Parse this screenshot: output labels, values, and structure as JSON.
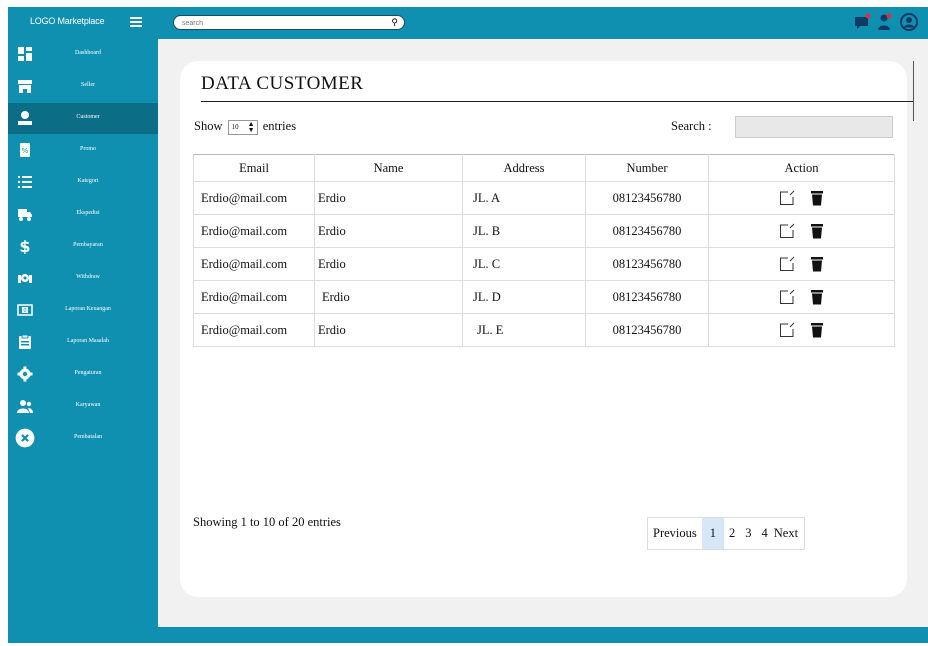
{
  "header": {
    "brand": "LOGO Marketplace",
    "search_placeholder": "search",
    "icons": [
      "chat-notification-icon",
      "user-notification-icon",
      "account-icon"
    ]
  },
  "sidebar": {
    "items": [
      {
        "label": "Dashboard",
        "icon": "dashboard-icon"
      },
      {
        "label": "Seller",
        "icon": "store-icon"
      },
      {
        "label": "Customer",
        "icon": "user-icon",
        "active": true
      },
      {
        "label": "Promo",
        "icon": "promo-tag-icon"
      },
      {
        "label": "Kategori",
        "icon": "list-icon"
      },
      {
        "label": "Ekspedisi",
        "icon": "truck-icon"
      },
      {
        "label": "Pembayaran",
        "icon": "dollar-icon"
      },
      {
        "label": "Withdraw",
        "icon": "withdraw-icon"
      },
      {
        "label": "Laporan Keuangan",
        "icon": "money-icon"
      },
      {
        "label": "Laporan Masalah",
        "icon": "report-icon"
      },
      {
        "label": "Pengaturan",
        "icon": "gear-icon"
      },
      {
        "label": "Karyawan",
        "icon": "users-icon"
      },
      {
        "label": "Pembatalan",
        "icon": "cancel-icon"
      }
    ]
  },
  "main": {
    "title": "DATA CUSTOMER",
    "show_label": "Show",
    "entries_value": "10",
    "entries_label": "entries",
    "search_label": "Search :",
    "columns": [
      "Email",
      "Name",
      "Address",
      "Number",
      "Action"
    ],
    "rows": [
      {
        "email": "Erdio@mail.com",
        "name": "Erdio",
        "address": "JL. A",
        "number": "08123456780"
      },
      {
        "email": "Erdio@mail.com",
        "name": "Erdio",
        "address": "JL. B",
        "number": "08123456780"
      },
      {
        "email": "Erdio@mail.com",
        "name": "Erdio",
        "address": "JL. C",
        "number": "08123456780"
      },
      {
        "email": "Erdio@mail.com",
        "name": "Erdio",
        "address": "JL. D",
        "number": "08123456780"
      },
      {
        "email": "Erdio@mail.com",
        "name": "Erdio",
        "address": "JL. E",
        "number": "08123456780"
      }
    ],
    "showing_text": "Showing 1 to 10 of 20 entries",
    "pagination": {
      "previous": "Previous",
      "pages": [
        "1",
        "2",
        "3",
        "4"
      ],
      "current": "1",
      "next": "Next"
    }
  },
  "colors": {
    "primary": "#1090b0",
    "sidebar_active": "#0c6e86",
    "content_bg": "#f1f1f1",
    "pager_active": "#d7e7f7",
    "notification": "#e0303a"
  }
}
